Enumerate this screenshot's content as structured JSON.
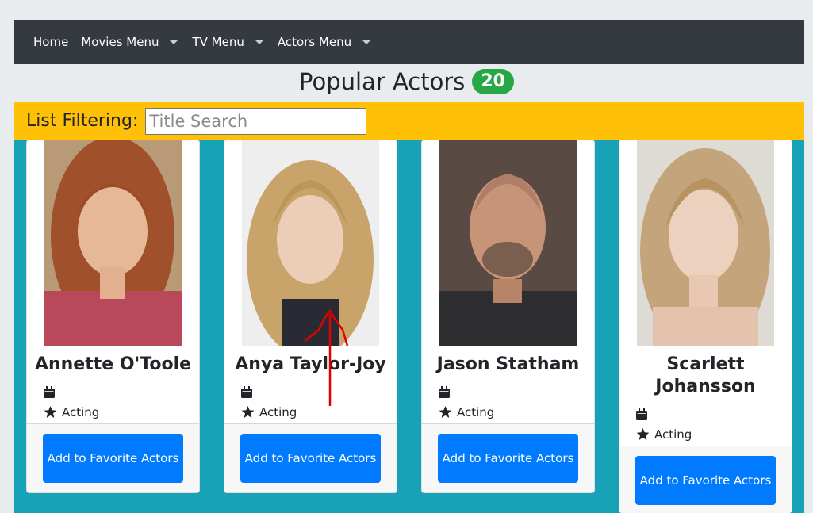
{
  "nav": {
    "home": "Home",
    "movies": "Movies Menu",
    "tv": "TV Menu",
    "actors": "Actors Menu"
  },
  "header": {
    "title": "Popular Actors",
    "count": "20"
  },
  "filter": {
    "label": "List Filtering:",
    "placeholder": "Title Search"
  },
  "colors": {
    "navbar": "#343a40",
    "filter_bar": "#ffc107",
    "cards_background": "#17a2b8",
    "badge": "#28a745",
    "button": "#007bff"
  },
  "cards": [
    {
      "name": "Annette O'Toole",
      "department": "Acting",
      "button": "Add to Favorite Actors",
      "icons": [
        "calendar-icon",
        "star-icon"
      ]
    },
    {
      "name": "Anya Taylor-Joy",
      "department": "Acting",
      "button": "Add to Favorite Actors",
      "icons": [
        "calendar-icon",
        "star-icon"
      ]
    },
    {
      "name": "Jason Statham",
      "department": "Acting",
      "button": "Add to Favorite Actors",
      "icons": [
        "calendar-icon",
        "star-icon"
      ]
    },
    {
      "name": "Scarlett Johansson",
      "department": "Acting",
      "button": "Add to Favorite Actors",
      "icons": [
        "calendar-icon",
        "star-icon"
      ]
    }
  ]
}
